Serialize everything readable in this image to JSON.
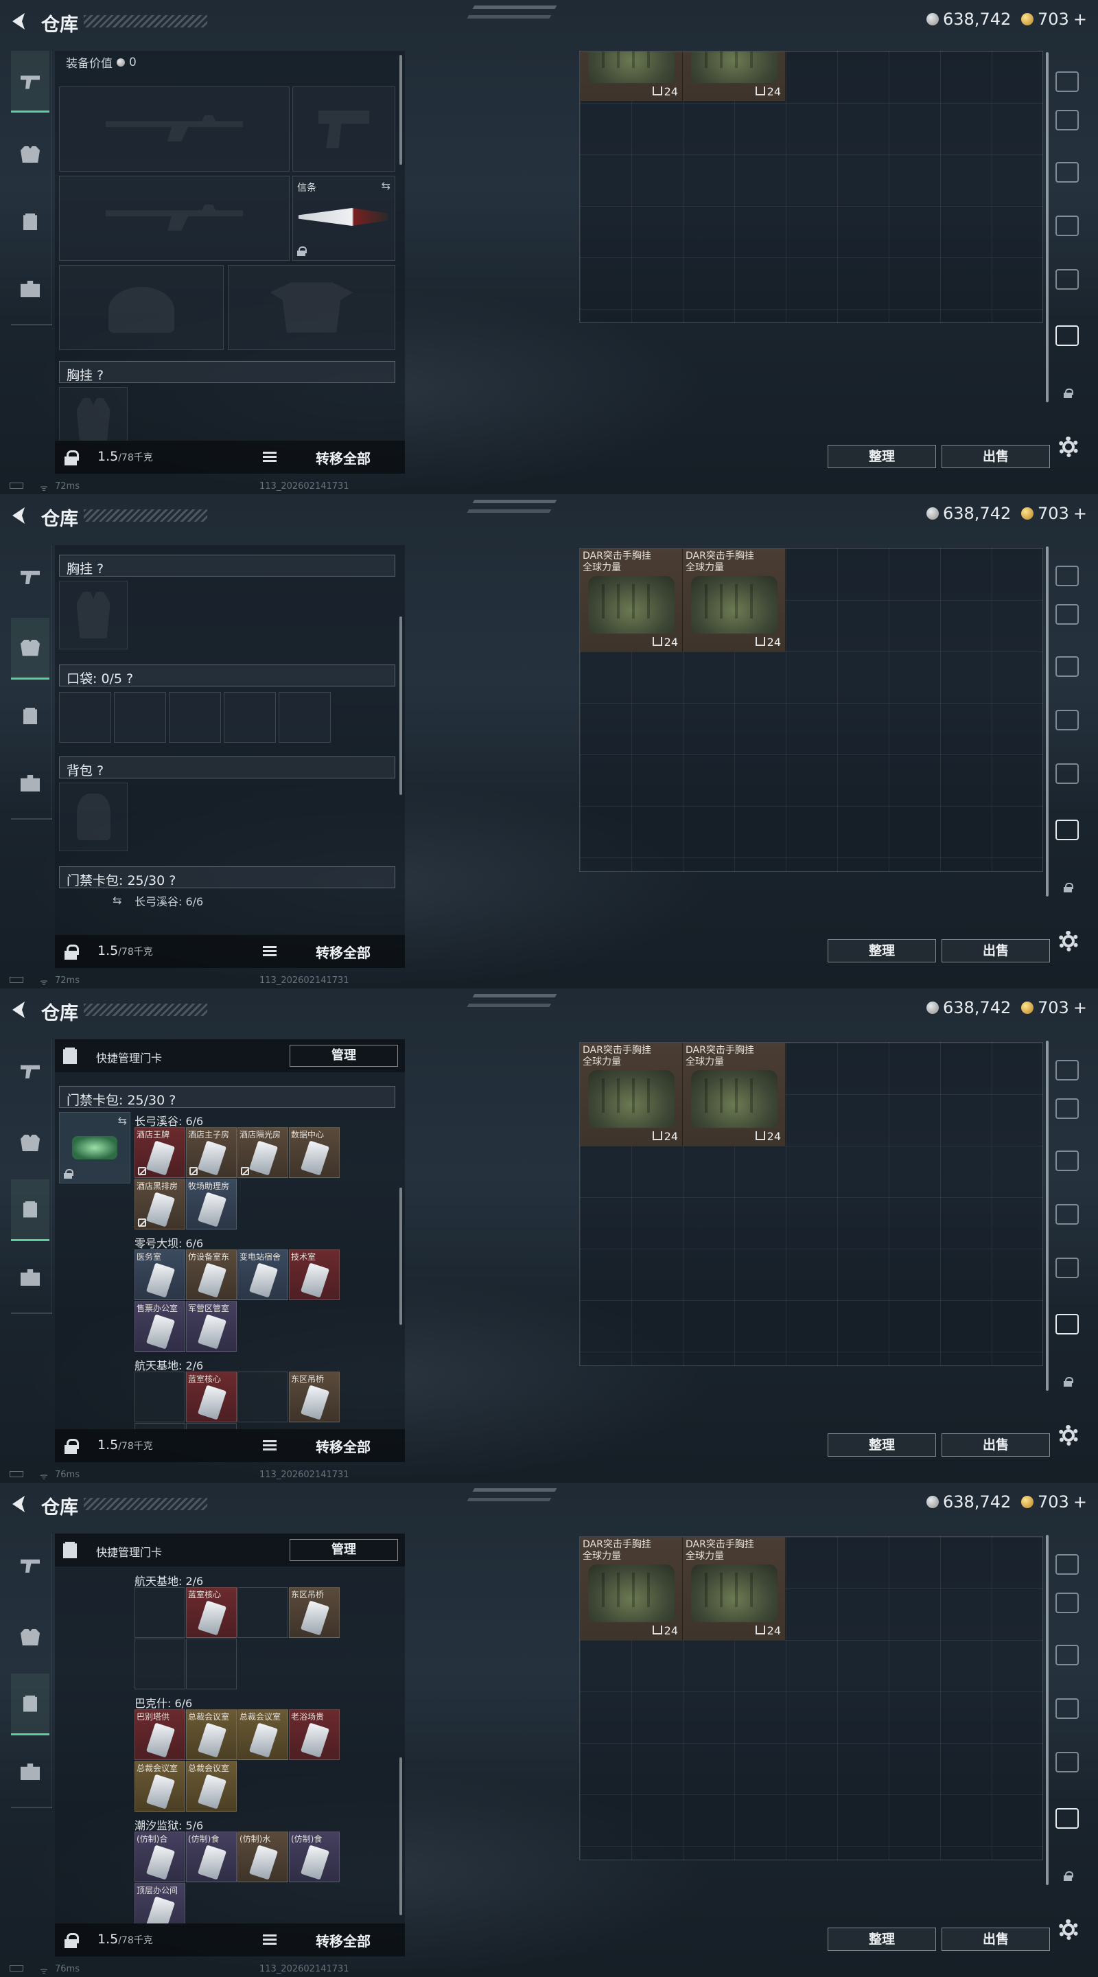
{
  "header": {
    "title": "仓库",
    "silver": "638,742",
    "gold": "703",
    "gold_plus": "+"
  },
  "footer": {
    "frames": [
      {
        "ping": "72ms",
        "build": "113_202602141731"
      },
      {
        "ping": "72ms",
        "build": "113_202602141731"
      },
      {
        "ping": "76ms",
        "build": "113_202602141731"
      },
      {
        "ping": "76ms",
        "build": "113_202602141731"
      }
    ]
  },
  "bottom": {
    "weight": "1.5",
    "weight_max": "/78千克",
    "transfer_all": "转移全部"
  },
  "stash": {
    "sort_label": "整理",
    "sell_label": "出售",
    "items": [
      {
        "name": "DAR突击手胸挂\n全球力量",
        "count": "24"
      },
      {
        "name": "DAR突击手胸挂\n全球力量",
        "count": "24"
      }
    ]
  },
  "right_nav": {
    "icons": [
      "safe-icon",
      "iv-helmet-icon",
      "iii-helmet-icon",
      "v-helmet-icon",
      "iv-armor-icon",
      "map-icon",
      "lock-icon",
      "settings-icon"
    ]
  },
  "loadout": {
    "equip_value_label": "装备价值",
    "equip_value": "0",
    "melee_label": "信条",
    "chest_rig_label": "胸挂 ?",
    "pockets_label": "口袋: 0/5 ?",
    "backpack_label": "背包 ?",
    "card_pack_label": "门禁卡包: 25/30 ?",
    "card_pack_peek": "长弓溪谷: 6/6"
  },
  "cards": {
    "quick_manage_label": "快捷管理门卡",
    "manage_label": "管理",
    "pack_label": "门禁卡包: 25/30 ?",
    "groups": [
      {
        "title": "长弓溪谷: 6/6",
        "cards": [
          {
            "name": "酒店王牌",
            "color": "red",
            "nodrop": true
          },
          {
            "name": "酒店主子房",
            "color": "brown",
            "nodrop": true
          },
          {
            "name": "酒店隔光房",
            "color": "brown",
            "nodrop": true
          },
          {
            "name": "数据中心",
            "color": "brown",
            "nodrop": false
          },
          {
            "name": "酒店黑排房",
            "color": "brown",
            "nodrop": true
          },
          {
            "name": "牧场助理房",
            "color": "blue",
            "nodrop": false
          }
        ]
      },
      {
        "title": "零号大坝: 6/6",
        "cards": [
          {
            "name": "医务室",
            "color": "blue",
            "nodrop": false
          },
          {
            "name": "仿设备室东",
            "color": "brown",
            "nodrop": false
          },
          {
            "name": "变电站宿舍",
            "color": "blue",
            "nodrop": false
          },
          {
            "name": "技术室",
            "color": "red",
            "nodrop": false
          },
          {
            "name": "售票办公室",
            "color": "purple",
            "nodrop": false
          },
          {
            "name": "军营区管室",
            "color": "purple",
            "nodrop": false
          }
        ]
      },
      {
        "title": "航天基地: 2/6",
        "cards": [
          {
            "name": "",
            "color": "empty",
            "nodrop": false
          },
          {
            "name": "蓝室核心",
            "color": "red",
            "nodrop": false
          },
          {
            "name": "",
            "color": "empty",
            "nodrop": false
          },
          {
            "name": "东区吊桥",
            "color": "brown",
            "nodrop": false
          },
          {
            "name": "",
            "color": "empty",
            "nodrop": false
          },
          {
            "name": "",
            "color": "empty",
            "nodrop": false
          }
        ]
      },
      {
        "title": "巴克什: 6/6",
        "cards": [
          {
            "name": "巴别塔供",
            "color": "red",
            "nodrop": false
          },
          {
            "name": "总裁会议室",
            "color": "gold",
            "nodrop": false
          },
          {
            "name": "总裁会议室",
            "color": "gold",
            "nodrop": false
          },
          {
            "name": "老浴场贵",
            "color": "red",
            "nodrop": false
          },
          {
            "name": "总裁会议室",
            "color": "gold",
            "nodrop": false
          },
          {
            "name": "总裁会议室",
            "color": "gold",
            "nodrop": false
          }
        ]
      },
      {
        "title": "潮汐监狱: 5/6",
        "cards": [
          {
            "name": "(仿制)合",
            "color": "purple",
            "nodrop": false
          },
          {
            "name": "(仿制)食",
            "color": "purple",
            "nodrop": false
          },
          {
            "name": "(仿制)水",
            "color": "brown",
            "nodrop": false
          },
          {
            "name": "(仿制)食",
            "color": "purple",
            "nodrop": false
          },
          {
            "name": "顶层办公间",
            "color": "purple",
            "nodrop": false
          }
        ]
      }
    ]
  }
}
